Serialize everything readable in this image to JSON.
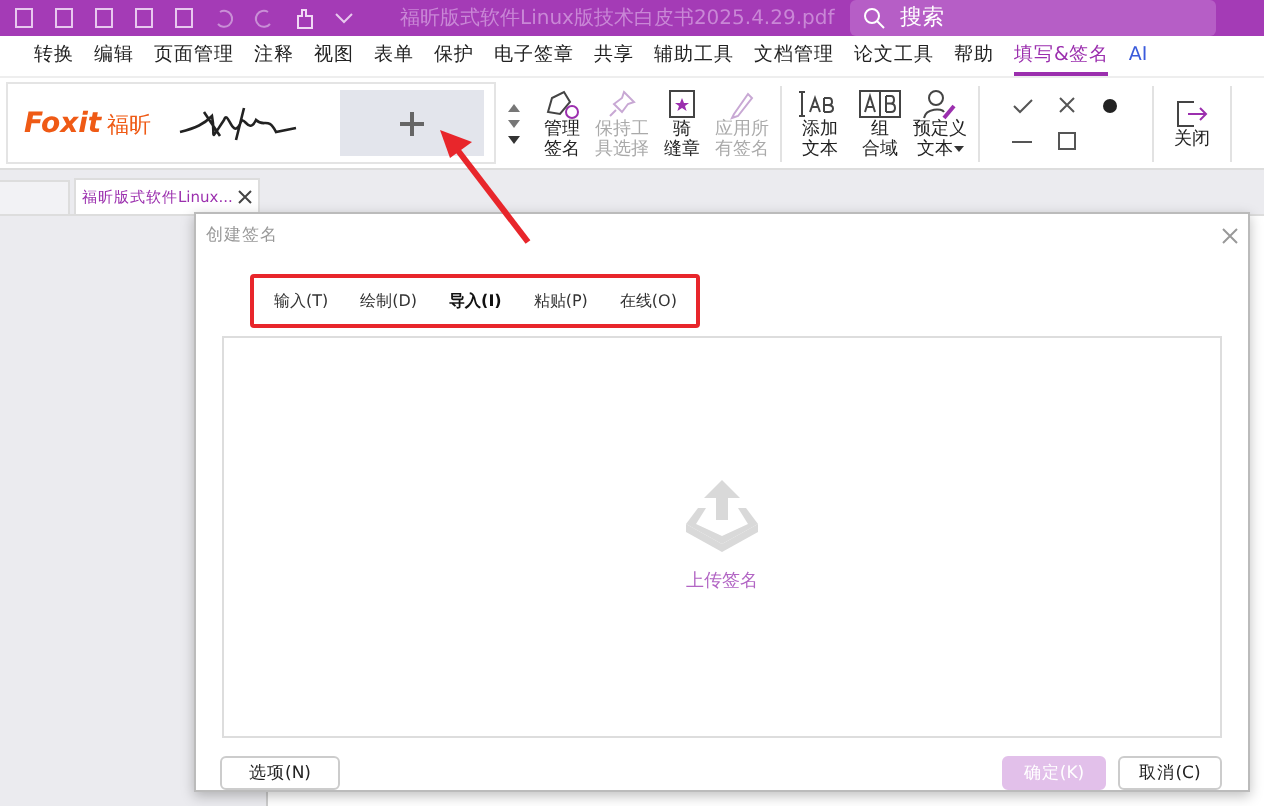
{
  "title_bar": {
    "title": "福昕版式软件Linux版技术白皮书2025.4.29.pdf",
    "search": {
      "placeholder": "搜索"
    }
  },
  "menu": [
    {
      "label": "转换",
      "selected": false
    },
    {
      "label": "编辑",
      "selected": false
    },
    {
      "label": "页面管理",
      "selected": false
    },
    {
      "label": "注释",
      "selected": false
    },
    {
      "label": "视图",
      "selected": false
    },
    {
      "label": "表单",
      "selected": false
    },
    {
      "label": "保护",
      "selected": false
    },
    {
      "label": "电子签章",
      "selected": false
    },
    {
      "label": "共享",
      "selected": false
    },
    {
      "label": "辅助工具",
      "selected": false
    },
    {
      "label": "文档管理",
      "selected": false
    },
    {
      "label": "论文工具",
      "selected": false
    },
    {
      "label": "帮助",
      "selected": false
    },
    {
      "label": "填写&签名",
      "selected": true
    },
    {
      "label": "AI",
      "selected": false
    }
  ],
  "ribbon": {
    "logo": {
      "latin": "Foxit",
      "chinese": "福昕"
    },
    "tools": [
      {
        "kind": "manage",
        "lines": [
          "管理",
          "签名"
        ],
        "disabled": false,
        "dropdown": false
      },
      {
        "kind": "pin",
        "lines": [
          "保持工",
          "具选择"
        ],
        "disabled": true,
        "dropdown": false
      },
      {
        "kind": "seam",
        "lines": [
          "骑",
          "缝章"
        ],
        "disabled": false,
        "dropdown": false
      },
      {
        "kind": "apply",
        "lines": [
          "应用所",
          "有签名"
        ],
        "disabled": true,
        "dropdown": false
      },
      {
        "kind": "addtext",
        "lines": [
          "添加",
          "文本"
        ],
        "disabled": false,
        "dropdown": false
      },
      {
        "kind": "field",
        "lines": [
          "组",
          "合域"
        ],
        "disabled": false,
        "dropdown": false
      },
      {
        "kind": "predef",
        "lines": [
          "预定义",
          "文本"
        ],
        "disabled": false,
        "dropdown": true
      }
    ],
    "close": {
      "label": "关闭"
    }
  },
  "document_tab": {
    "label": "福昕版式软件Linux...",
    "selected": true
  },
  "dialog": {
    "title": "创建签名",
    "tabs": [
      {
        "label": "输入(T)",
        "selected": false
      },
      {
        "label": "绘制(D)",
        "selected": false
      },
      {
        "label": "导入(I)",
        "selected": true
      },
      {
        "label": "粘贴(P)",
        "selected": false
      },
      {
        "label": "在线(O)",
        "selected": false
      }
    ],
    "upload_label": "上传签名",
    "options_button": {
      "label": "选项(N)"
    },
    "confirm_button": {
      "label": "确定(K)",
      "disabled": true
    },
    "cancel_button": {
      "label": "取消(C)",
      "disabled": false
    }
  }
}
